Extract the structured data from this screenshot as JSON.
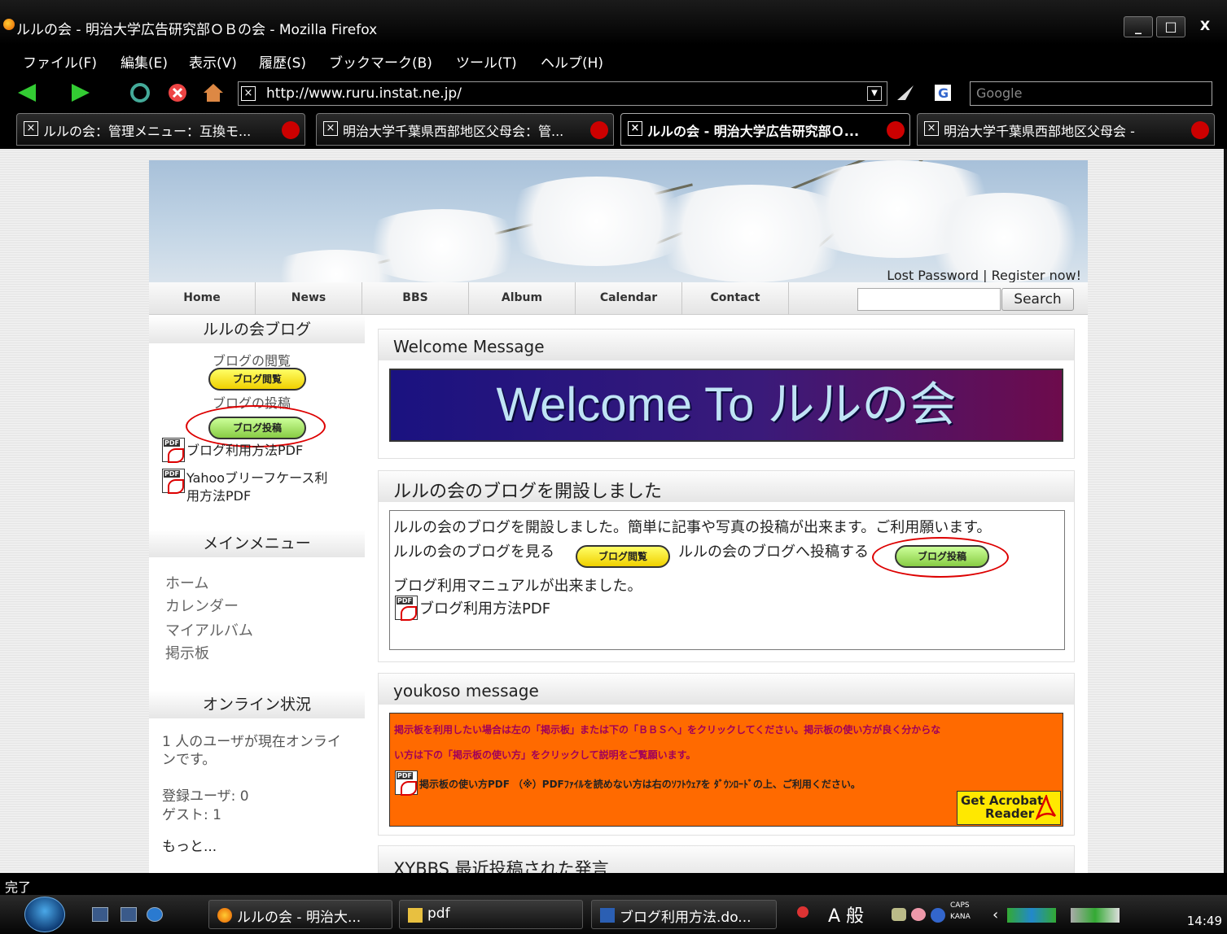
{
  "window": {
    "title": "ルルの会 - 明治大学広告研究部ＯＢの会 - Mozilla Firefox",
    "min": "_",
    "max": "□",
    "close": "X"
  },
  "menu": [
    "ファイル(F)",
    "編集(E)",
    "表示(V)",
    "履歴(S)",
    "ブックマーク(B)",
    "ツール(T)",
    "ヘルプ(H)"
  ],
  "navbar": {
    "url": "http://www.ruru.instat.ne.jp/",
    "search_engine_placeholder": "Google"
  },
  "tabs": [
    {
      "label": "ルルの会：管理メニュー：互換モ..."
    },
    {
      "label": "明治大学千葉県西部地区父母会：管..."
    },
    {
      "label": "ルルの会 - 明治大学広告研究部Ｏ..."
    },
    {
      "label": "明治大学千葉県西部地区父母会 -"
    }
  ],
  "site": {
    "header_links": "Lost Password | Register now!",
    "nav": [
      "Home",
      "News",
      "BBS",
      "Album",
      "Calendar",
      "Contact"
    ],
    "search_button": "Search",
    "sidebar": {
      "blog_heading": "ルルの会ブログ",
      "blog_view_label": "ブログの閲覧",
      "blog_view_button": "ブログ閲覧",
      "blog_post_label": "ブログの投稿",
      "blog_post_button": "ブログ投稿",
      "pdf_link_1": "ブログ利用方法PDF",
      "pdf_link_2_line1": "Yahooブリーフケース利",
      "pdf_link_2_line2": "用方法PDF",
      "main_menu_heading": "メインメニュー",
      "main_menu": [
        "ホーム",
        "カレンダー",
        "マイアルバム",
        "掲示板"
      ],
      "online_heading": "オンライン状況",
      "online_line1": "1 人のユーザが現在オンライ",
      "online_line2": "ンです。",
      "registered": "登録ユーザ: 0",
      "guests": "ゲスト: 1",
      "more": "もっと..."
    },
    "welcome": {
      "heading": "Welcome Message",
      "banner": "Welcome To ルルの会"
    },
    "blog_box": {
      "heading": "ルルの会のブログを開設しました",
      "line1": "ルルの会のブログを開設しました。簡単に記事や写真の投稿が出来ます。ご利用願います。",
      "line2a": "ルルの会のブログを見る",
      "line2b": "ルルの会のブログへ投稿する",
      "view_button": "ブログ閲覧",
      "post_button": "ブログ投稿",
      "line3": "ブログ利用マニュアルが出来ました。",
      "pdf_link": "ブログ利用方法PDF"
    },
    "youkoso": {
      "heading": "youkoso message",
      "line1": "掲示板を利用したい場合は左の「掲示板」または下の「ＢＢＳへ」をクリックしてください。掲示板の使い方が良く分からな",
      "line2": "い方は下の「掲示板の使い方」をクリックして説明をご覧願います。",
      "line3": "掲示板の使い方PDF （※）PDFﾌｧｲﾙを読めない方は右のｿﾌﾄｳｪｱを ﾀﾞｳﾝﾛｰﾄﾞの上、ご利用ください。",
      "acrobat_line1": "Get Acrobat",
      "acrobat_line2": "Reader"
    },
    "xybbs_heading": "XYBBS 最近投稿された発言"
  },
  "status": "完了",
  "taskbar": {
    "tasks": [
      "ルルの会 - 明治大...",
      "pdf",
      "ブログ利用方法.do..."
    ],
    "ime": "A 般",
    "caps": "CAPS",
    "kana": "KANA",
    "clock": "14:49"
  },
  "colors": {
    "welcome_gradient_start": "#1a1280",
    "welcome_gradient_end": "#6d0b4c",
    "orange_panel": "#ff6a00",
    "highlight_ellipse": "#dd0000"
  }
}
